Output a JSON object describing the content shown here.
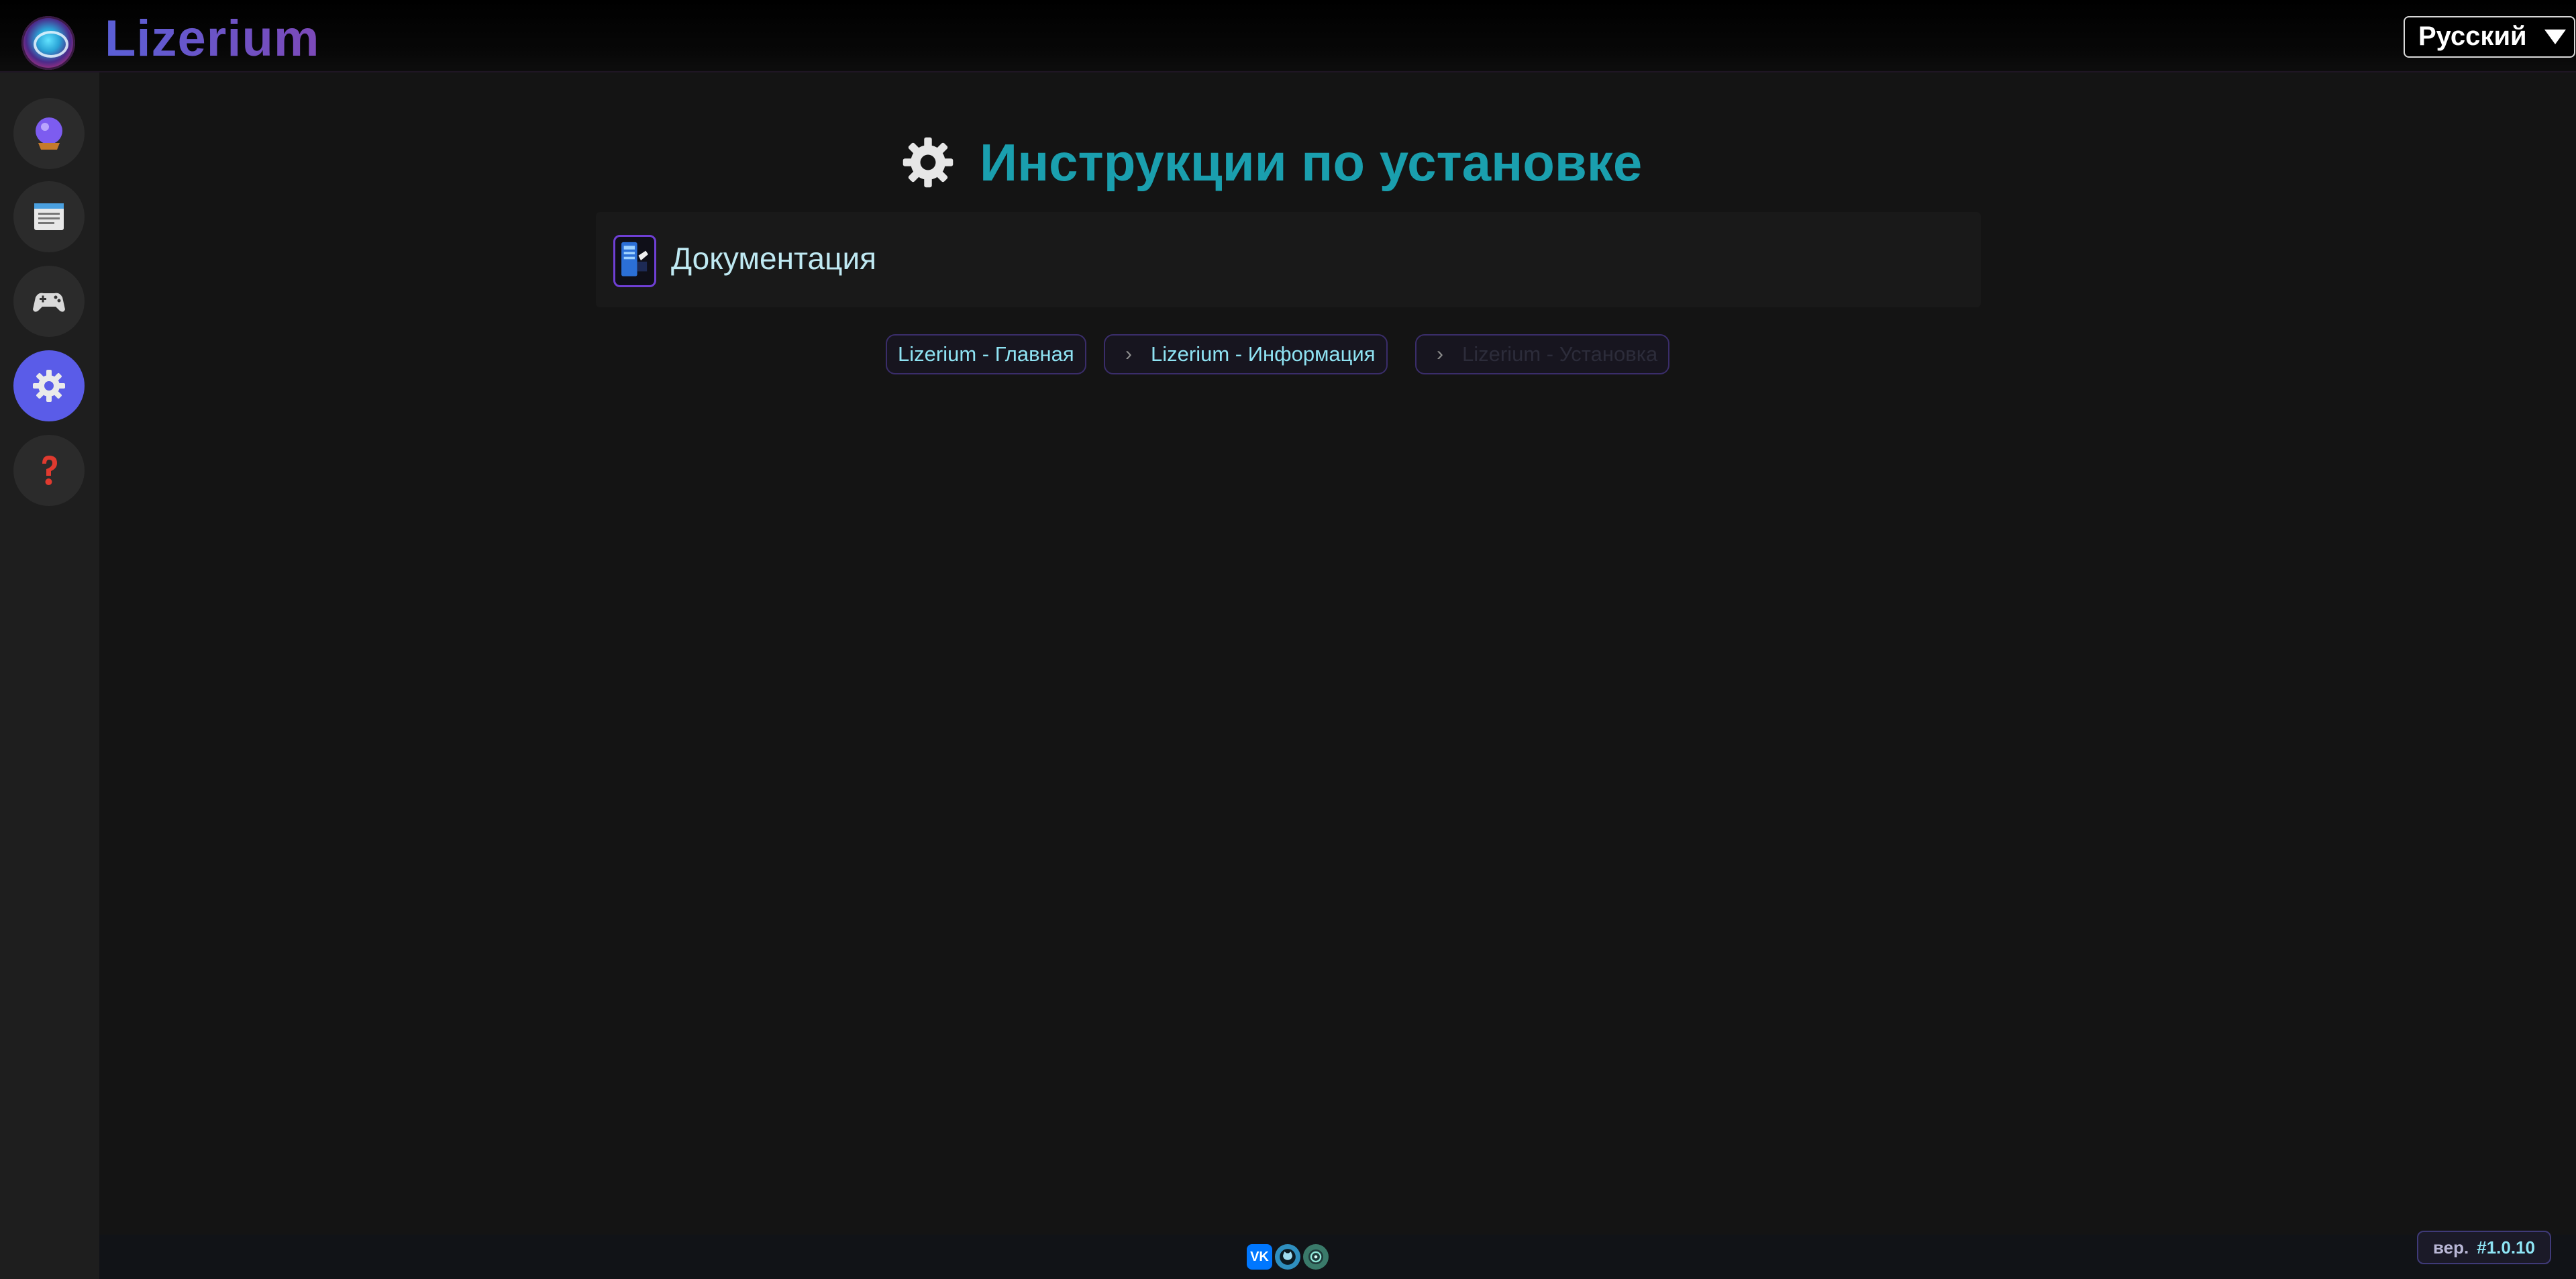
{
  "header": {
    "brand": "Lizerium",
    "language": "Русский"
  },
  "sidebar": {
    "items": [
      {
        "icon": "crystal-ball-icon",
        "active": false
      },
      {
        "icon": "newspaper-icon",
        "active": false
      },
      {
        "icon": "gamepad-icon",
        "active": false
      },
      {
        "icon": "gear-icon",
        "active": true
      },
      {
        "icon": "question-icon",
        "active": false
      }
    ]
  },
  "main": {
    "title": "Инструкции по установке",
    "doc_link": "Документация",
    "breadcrumbs": [
      {
        "label": "Lizerium - Главная",
        "sep": ""
      },
      {
        "label": "Lizerium - Информация",
        "sep": "›"
      },
      {
        "label": "Lizerium - Установка",
        "sep": "›"
      }
    ]
  },
  "footer": {
    "social": [
      {
        "icon": "vk-icon",
        "text": "VK",
        "color": "#0077ff"
      },
      {
        "icon": "github-icon",
        "text": "",
        "color": "#2f8fbf"
      },
      {
        "icon": "site-icon",
        "text": "",
        "color": "#3a7a6a"
      }
    ],
    "version_label": "вер.",
    "version_value": "#1.0.10"
  },
  "colors": {
    "accent": "#5a5ce8",
    "title": "#1a9fae",
    "breadcrumb_text": "#8fe3f3"
  }
}
